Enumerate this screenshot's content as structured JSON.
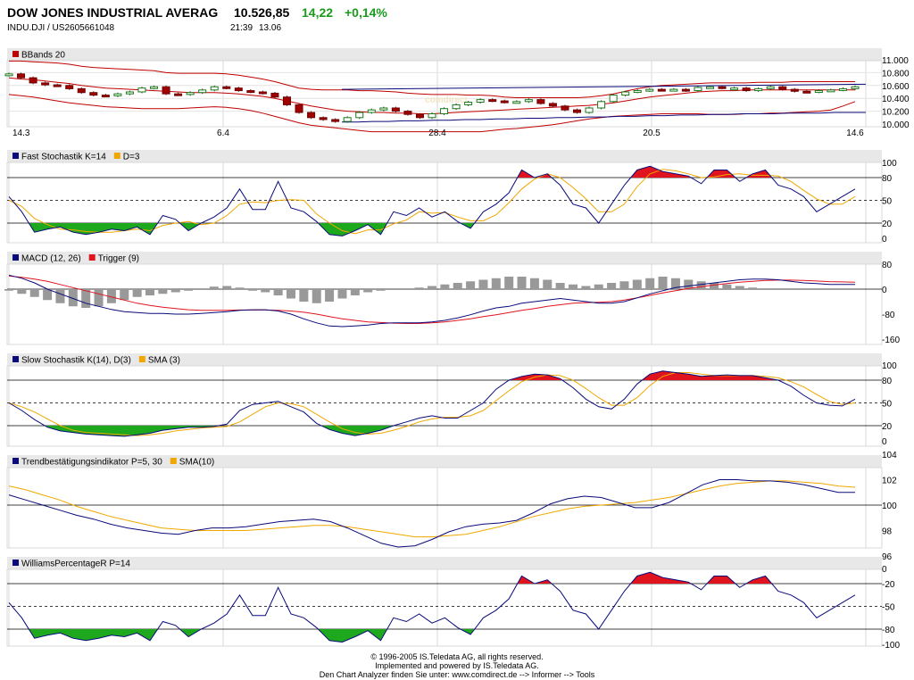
{
  "header": {
    "name": "DOW JONES INDUSTRIAL AVERAG",
    "price": "10.526,85",
    "change": "14,22",
    "change_pct": "+0,14%",
    "symbol": "INDU.DJI  /  US2605661048",
    "time": "21:39",
    "date": "13.06"
  },
  "colors": {
    "up": "#1ea81e",
    "down": "#e0141e",
    "navy": "#0a0a7a",
    "orange": "#f0a800",
    "red_line": "#c00000",
    "hist": "#999999",
    "panel_header": "#e8e8e8"
  },
  "x_axis": [
    "14.3",
    "6.4",
    "28.4",
    "20.5",
    "14.6"
  ],
  "footer": [
    "© 1996-2005 IS.Teledata AG, all rights reserved.",
    "Implemented and powered by IS.Teledata AG.",
    "Den Chart Analyzer finden Sie unter: www.comdirect.de --> Informer --> Tools"
  ],
  "watermark": "comdirect",
  "chart_data": [
    {
      "type": "candlestick",
      "legend": [
        {
          "name": "BBands 20",
          "color": "#c00000"
        }
      ],
      "ylim": [
        10.0,
        11.0
      ],
      "y_ticks": [
        "11.000",
        "10.800",
        "10.600",
        "10.400",
        "10.200",
        "10.000"
      ],
      "series": {
        "close": [
          10.78,
          10.72,
          10.64,
          10.61,
          10.6,
          10.55,
          10.49,
          10.45,
          10.44,
          10.47,
          10.5,
          10.56,
          10.58,
          10.47,
          10.46,
          10.49,
          10.53,
          10.58,
          10.56,
          10.52,
          10.5,
          10.48,
          10.42,
          10.3,
          10.18,
          10.1,
          10.07,
          10.04,
          10.1,
          10.18,
          10.22,
          10.25,
          10.2,
          10.15,
          10.1,
          10.16,
          10.24,
          10.3,
          10.34,
          10.38,
          10.36,
          10.34,
          10.35,
          10.38,
          10.32,
          10.28,
          10.22,
          10.18,
          10.25,
          10.35,
          10.45,
          10.5,
          10.52,
          10.54,
          10.53,
          10.54,
          10.52,
          10.57,
          10.58,
          10.56,
          10.56,
          10.52,
          10.55,
          10.58,
          10.54,
          10.51,
          10.5,
          10.52,
          10.53,
          10.55,
          10.58
        ],
        "upper": [
          10.98,
          10.98,
          10.97,
          10.96,
          10.95,
          10.93,
          10.9,
          10.88,
          10.87,
          10.86,
          10.85,
          10.84,
          10.83,
          10.8,
          10.79,
          10.79,
          10.79,
          10.79,
          10.78,
          10.76,
          10.73,
          10.7,
          10.66,
          10.61,
          10.56,
          10.54,
          10.53,
          10.53,
          10.53,
          10.52,
          10.52,
          10.51,
          10.5,
          10.48,
          10.47,
          10.46,
          10.46,
          10.46,
          10.45,
          10.45,
          10.44,
          10.42,
          10.41,
          10.41,
          10.41,
          10.41,
          10.41,
          10.41,
          10.42,
          10.44,
          10.47,
          10.51,
          10.55,
          10.58,
          10.6,
          10.61,
          10.62,
          10.63,
          10.64,
          10.64,
          10.64,
          10.64,
          10.65,
          10.65,
          10.65,
          10.66,
          10.66,
          10.66,
          10.66,
          10.66,
          10.66
        ],
        "middle": [
          10.72,
          10.7,
          10.69,
          10.67,
          10.65,
          10.63,
          10.6,
          10.58,
          10.56,
          10.55,
          10.54,
          10.53,
          10.52,
          10.51,
          10.5,
          10.49,
          10.49,
          10.49,
          10.48,
          10.47,
          10.45,
          10.43,
          10.4,
          10.36,
          10.32,
          10.28,
          10.25,
          10.22,
          10.2,
          10.19,
          10.18,
          10.18,
          10.17,
          10.17,
          10.16,
          10.16,
          10.17,
          10.18,
          10.19,
          10.2,
          10.21,
          10.22,
          10.23,
          10.24,
          10.25,
          10.26,
          10.27,
          10.28,
          10.29,
          10.31,
          10.33,
          10.36,
          10.39,
          10.42,
          10.44,
          10.46,
          10.48,
          10.5,
          10.51,
          10.52,
          10.52,
          10.53,
          10.53,
          10.53,
          10.53,
          10.53,
          10.53,
          10.53,
          10.53,
          10.53,
          10.53
        ],
        "lower": [
          10.46,
          10.44,
          10.42,
          10.39,
          10.36,
          10.33,
          10.31,
          10.29,
          10.27,
          10.26,
          10.25,
          10.24,
          10.24,
          10.24,
          10.24,
          10.25,
          10.26,
          10.27,
          10.26,
          10.24,
          10.21,
          10.17,
          10.12,
          10.07,
          10.02,
          9.98,
          9.96,
          9.94,
          9.92,
          9.9,
          9.88,
          9.88,
          9.88,
          9.88,
          9.88,
          9.88,
          9.88,
          9.88,
          9.88,
          9.88,
          9.9,
          9.92,
          9.93,
          9.95,
          9.97,
          9.99,
          10.02,
          10.05,
          10.08,
          10.1,
          10.12,
          10.13,
          10.14,
          10.15,
          10.16,
          10.16,
          10.16,
          10.16,
          10.15,
          10.15,
          10.15,
          10.16,
          10.16,
          10.17,
          10.17,
          10.18,
          10.19,
          10.2,
          10.22,
          10.28,
          10.35
        ],
        "blue": [
          10.03,
          10.03,
          10.04,
          10.04,
          10.05,
          10.05,
          10.06,
          10.06,
          10.07,
          10.07,
          10.08,
          10.08,
          10.09,
          10.09,
          10.1,
          10.1,
          10.11,
          10.11,
          10.12,
          10.12,
          10.13,
          10.13,
          10.14,
          10.14,
          10.15,
          10.15,
          10.16,
          10.16,
          10.16,
          10.17,
          10.17,
          10.17,
          10.18,
          10.18,
          10.18
        ]
      }
    },
    {
      "type": "line",
      "legend": [
        {
          "name": "Fast Stochastik K=14",
          "color": "#0a0a7a"
        },
        {
          "name": "D=3",
          "color": "#f0a800"
        }
      ],
      "ylim": [
        0,
        100
      ],
      "y_ticks": [
        "100",
        "80",
        "50",
        "20",
        "0"
      ],
      "levels": [
        80,
        50,
        20
      ],
      "series": {
        "k": [
          55,
          35,
          8,
          12,
          15,
          8,
          5,
          8,
          12,
          10,
          15,
          5,
          30,
          25,
          10,
          20,
          28,
          40,
          65,
          38,
          38,
          75,
          40,
          35,
          22,
          5,
          3,
          10,
          18,
          5,
          35,
          30,
          40,
          28,
          35,
          22,
          13,
          35,
          45,
          60,
          90,
          80,
          85,
          70,
          45,
          40,
          20,
          45,
          70,
          90,
          95,
          88,
          85,
          82,
          72,
          90,
          90,
          75,
          85,
          90,
          70,
          65,
          55,
          35,
          45,
          55,
          65
        ],
        "d": [
          50,
          42,
          26,
          18,
          12,
          11,
          9,
          8,
          8,
          10,
          12,
          10,
          17,
          20,
          22,
          18,
          20,
          30,
          45,
          48,
          47,
          50,
          51,
          50,
          32,
          20,
          10,
          6,
          11,
          11,
          19,
          24,
          35,
          33,
          34,
          28,
          23,
          23,
          31,
          47,
          65,
          78,
          85,
          80,
          67,
          52,
          35,
          35,
          45,
          68,
          85,
          91,
          89,
          85,
          80,
          81,
          84,
          85,
          83,
          83,
          82,
          75,
          63,
          52,
          45,
          45,
          55
        ]
      }
    },
    {
      "type": "bar_line",
      "legend": [
        {
          "name": "MACD (12, 26)",
          "color": "#0a0a7a"
        },
        {
          "name": "Trigger (9)",
          "color": "#e0141e"
        }
      ],
      "ylim": [
        -160,
        80
      ],
      "y_ticks": [
        "80",
        "0",
        "-80",
        "-160"
      ],
      "series": {
        "macd": [
          45,
          35,
          20,
          0,
          -15,
          -30,
          -45,
          -55,
          -65,
          -72,
          -75,
          -78,
          -78,
          -80,
          -80,
          -78,
          -75,
          -72,
          -68,
          -66,
          -66,
          -70,
          -80,
          -95,
          -108,
          -118,
          -120,
          -118,
          -115,
          -110,
          -108,
          -108,
          -108,
          -105,
          -100,
          -92,
          -82,
          -70,
          -60,
          -55,
          -45,
          -40,
          -35,
          -30,
          -35,
          -40,
          -45,
          -45,
          -40,
          -28,
          -15,
          -5,
          5,
          10,
          15,
          20,
          25,
          30,
          32,
          32,
          30,
          25,
          20,
          18,
          15,
          15,
          15
        ],
        "trigger": [
          42,
          38,
          32,
          25,
          15,
          5,
          -5,
          -15,
          -25,
          -35,
          -45,
          -52,
          -58,
          -62,
          -66,
          -68,
          -68,
          -68,
          -67,
          -67,
          -67,
          -68,
          -70,
          -74,
          -80,
          -88,
          -95,
          -100,
          -105,
          -107,
          -109,
          -110,
          -110,
          -108,
          -105,
          -100,
          -95,
          -88,
          -82,
          -75,
          -68,
          -62,
          -55,
          -50,
          -45,
          -43,
          -42,
          -40,
          -35,
          -28,
          -20,
          -12,
          -5,
          2,
          8,
          13,
          18,
          22,
          25,
          28,
          29,
          29,
          28,
          26,
          24,
          23,
          22
        ],
        "hist": [
          -5,
          -15,
          -25,
          -35,
          -45,
          -55,
          -60,
          -55,
          -45,
          -35,
          -25,
          -20,
          -15,
          -10,
          -5,
          0,
          8,
          10,
          5,
          -5,
          -10,
          -20,
          -30,
          -40,
          -45,
          -40,
          -30,
          -20,
          -10,
          -5,
          0,
          0,
          5,
          10,
          15,
          20,
          25,
          30,
          35,
          40,
          40,
          35,
          30,
          20,
          15,
          10,
          15,
          20,
          25,
          30,
          35,
          40,
          35,
          30,
          25,
          20,
          15,
          10,
          5,
          0,
          0,
          0,
          0,
          0,
          0,
          0,
          0
        ]
      }
    },
    {
      "type": "line",
      "legend": [
        {
          "name": "Slow Stochastik K(14), D(3)",
          "color": "#0a0a7a"
        },
        {
          "name": "SMA (3)",
          "color": "#f0a800"
        }
      ],
      "ylim": [
        0,
        100
      ],
      "y_ticks": [
        "100",
        "80",
        "50",
        "20",
        "0"
      ],
      "levels": [
        80,
        50,
        20
      ],
      "series": {
        "k": [
          50,
          40,
          28,
          18,
          13,
          11,
          9,
          8,
          7,
          6,
          8,
          10,
          14,
          16,
          18,
          18,
          19,
          22,
          40,
          48,
          50,
          52,
          45,
          38,
          23,
          15,
          10,
          7,
          10,
          14,
          20,
          25,
          30,
          33,
          30,
          30,
          40,
          50,
          68,
          80,
          85,
          88,
          87,
          82,
          70,
          55,
          45,
          42,
          55,
          75,
          88,
          92,
          90,
          88,
          85,
          86,
          87,
          86,
          86,
          83,
          80,
          72,
          60,
          50,
          47,
          46,
          55
        ],
        "d": [
          50,
          45,
          38,
          29,
          20,
          14,
          11,
          10,
          9,
          8,
          7,
          8,
          10,
          13,
          15,
          17,
          18,
          19,
          25,
          35,
          45,
          50,
          49,
          45,
          35,
          25,
          16,
          11,
          9,
          10,
          14,
          19,
          25,
          29,
          31,
          31,
          33,
          40,
          53,
          66,
          78,
          84,
          87,
          86,
          80,
          69,
          57,
          47,
          47,
          57,
          73,
          85,
          90,
          90,
          88,
          86,
          86,
          86,
          86,
          85,
          83,
          78,
          71,
          61,
          52,
          48,
          50
        ]
      }
    },
    {
      "type": "line",
      "legend": [
        {
          "name": "Trendbestätigungsindikator P=5, 30",
          "color": "#0a0a7a"
        },
        {
          "name": "SMA(10)",
          "color": "#f0a800"
        }
      ],
      "ylim": [
        96,
        104
      ],
      "y_ticks": [
        "104",
        "102",
        "100",
        "98",
        "96"
      ],
      "levels": [
        100
      ],
      "series": {
        "trend": [
          100.8,
          100.4,
          100,
          99.6,
          99.2,
          98.9,
          98.5,
          98.2,
          98,
          97.8,
          97.7,
          98,
          98.2,
          98.2,
          98.3,
          98.5,
          98.7,
          98.8,
          98.9,
          98.7,
          98.2,
          97.6,
          97,
          96.7,
          96.8,
          97.3,
          97.9,
          98.3,
          98.5,
          98.6,
          98.8,
          99.4,
          100.1,
          100.5,
          100.7,
          100.6,
          100.2,
          99.8,
          99.8,
          100.2,
          100.9,
          101.6,
          102,
          102,
          101.9,
          101.9,
          101.8,
          101.6,
          101.3,
          101,
          101
        ],
        "sma": [
          101.5,
          101.2,
          100.8,
          100.4,
          99.9,
          99.5,
          99.1,
          98.8,
          98.5,
          98.2,
          98.1,
          98,
          98,
          98,
          98,
          98.1,
          98.2,
          98.3,
          98.4,
          98.4,
          98.3,
          98.1,
          97.9,
          97.7,
          97.5,
          97.5,
          97.6,
          97.7,
          98,
          98.3,
          98.7,
          99.1,
          99.4,
          99.7,
          99.9,
          100,
          100.1,
          100.2,
          100.4,
          100.6,
          100.9,
          101.2,
          101.5,
          101.7,
          101.8,
          101.9,
          101.9,
          101.8,
          101.7,
          101.5,
          101.4
        ]
      }
    },
    {
      "type": "line",
      "legend": [
        {
          "name": "WilliamsPercentageR P=14",
          "color": "#0a0a7a"
        }
      ],
      "ylim": [
        -100,
        0
      ],
      "y_ticks": [
        "0",
        "-20",
        "-50",
        "-80",
        "-100"
      ],
      "levels": [
        -20,
        -50,
        -80
      ],
      "series": {
        "r": [
          -45,
          -65,
          -92,
          -88,
          -85,
          -92,
          -95,
          -92,
          -88,
          -90,
          -85,
          -95,
          -70,
          -75,
          -90,
          -80,
          -72,
          -60,
          -35,
          -62,
          -62,
          -25,
          -60,
          -65,
          -78,
          -95,
          -97,
          -90,
          -82,
          -95,
          -65,
          -70,
          -60,
          -72,
          -65,
          -78,
          -87,
          -65,
          -55,
          -40,
          -10,
          -20,
          -15,
          -30,
          -55,
          -60,
          -80,
          -55,
          -30,
          -10,
          -5,
          -12,
          -15,
          -18,
          -28,
          -10,
          -10,
          -25,
          -15,
          -10,
          -30,
          -35,
          -45,
          -65,
          -55,
          -45,
          -35
        ]
      }
    }
  ]
}
